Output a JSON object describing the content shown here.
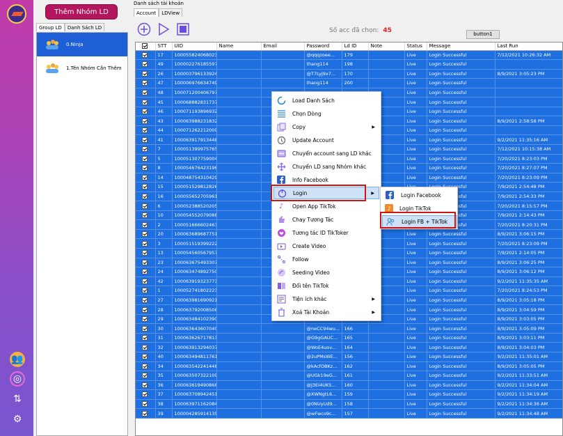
{
  "sidebar": {
    "add_group_button": "Thêm Nhóm LD",
    "tabs": [
      "Group LD",
      "Danh Sách LD"
    ],
    "groups": [
      {
        "label": "0.Ninja",
        "selected": true
      },
      {
        "label": "1.Tên Nhóm Cần Thêm",
        "selected": false
      }
    ],
    "strip_icons": [
      "group-icon",
      "refresh-circle-icon",
      "sync-icon",
      "settings-icon"
    ]
  },
  "main": {
    "section_title": "Danh sách tài khoản",
    "tabs": [
      "Account",
      "LDView"
    ],
    "toolbar_icons": [
      "add-icon",
      "play-icon",
      "stop-icon"
    ],
    "selected_label": "Số acc đã chọn:",
    "selected_count": "45",
    "button1_label": "button1"
  },
  "table": {
    "columns": [
      "STT",
      "UID",
      "Name",
      "Email",
      "Password",
      "Ld ID",
      "Note",
      "Status",
      "Message",
      "Last Run"
    ],
    "rows": [
      [
        "17",
        "100055824068023",
        "",
        "",
        "@qqqzoee...",
        "179",
        "",
        "Live",
        "Login Successful",
        "7/12/2021 10:26:32 AM"
      ],
      [
        "49",
        "100002276185597",
        "",
        "",
        "thang114",
        "198",
        "",
        "Live",
        "Login Successful",
        ""
      ],
      [
        "26",
        "100003796133924",
        "",
        "",
        "@T7Lyj9x7...",
        "170",
        "",
        "Live",
        "Login Successful",
        "8/9/2021 3:05:23 PM"
      ],
      [
        "47",
        "100006976634749",
        "",
        "",
        "thang114",
        "200",
        "",
        "Live",
        "Login Successful",
        ""
      ],
      [
        "48",
        "100071200406797",
        "",
        "",
        "",
        "",
        "",
        "Live",
        "Login Successful",
        ""
      ],
      [
        "45",
        "100068882831737",
        "",
        "",
        "",
        "",
        "",
        "Live",
        "Login Successful",
        ""
      ],
      [
        "46",
        "100071193896932",
        "",
        "",
        "",
        "",
        "",
        "Live",
        "Login Successful",
        ""
      ],
      [
        "43",
        "100063988231832",
        "",
        "",
        "",
        "",
        "",
        "Live",
        "Login Successful",
        "8/9/2021 2:58:58 PM"
      ],
      [
        "44",
        "100071262212009",
        "",
        "",
        "",
        "",
        "",
        "Live",
        "Login Successful",
        ""
      ],
      [
        "41",
        "100063917913448",
        "",
        "",
        "",
        "",
        "",
        "Live",
        "Login Successful",
        "9/2/2021 11:35:16 AM"
      ],
      [
        "7",
        "100051399975765",
        "",
        "",
        "",
        "",
        "",
        "Live",
        "Login Successful",
        "7/12/2021 10:15:38 AM"
      ],
      [
        "5",
        "100051307759004",
        "",
        "",
        "",
        "",
        "",
        "Live",
        "Login Successful",
        "7/20/2021 8:23:03 PM"
      ],
      [
        "8",
        "100054676423196",
        "",
        "",
        "",
        "",
        "",
        "Live",
        "Login Successful",
        "7/20/2021 8:27:07 PM"
      ],
      [
        "14",
        "100048754310429",
        "",
        "",
        "",
        "",
        "",
        "Live",
        "Login Successful",
        "7/20/2021 8:23:09 PM"
      ],
      [
        "15",
        "100051529812826",
        "",
        "",
        "",
        "",
        "",
        "Live",
        "Login Successful",
        "7/9/2021 2:54:48 PM"
      ],
      [
        "16",
        "100055652705961",
        "",
        "",
        "",
        "",
        "",
        "Live",
        "Login Successful",
        "7/9/2021 2:54:33 PM"
      ],
      [
        "6",
        "100052388520205",
        "",
        "",
        "",
        "",
        "",
        "Live",
        "Login Successful",
        "7/20/2021 8:15:57 PM"
      ],
      [
        "10",
        "100054552079088",
        "",
        "",
        "",
        "",
        "",
        "Live",
        "Login Successful",
        "7/9/2021 2:14:43 PM"
      ],
      [
        "2",
        "100051666602463",
        "",
        "",
        "",
        "",
        "",
        "Live",
        "Login Successful",
        "7/20/2021 8:20:31 PM"
      ],
      [
        "20",
        "100063689687751",
        "",
        "",
        "",
        "",
        "",
        "Live",
        "Login Successful",
        "8/9/2021 3:06:15 PM"
      ],
      [
        "3",
        "100051519399222",
        "",
        "",
        "",
        "",
        "",
        "Live",
        "Login Successful",
        "7/20/2021 8:23:09 PM"
      ],
      [
        "13",
        "100054560567957",
        "",
        "",
        "",
        "",
        "",
        "Live",
        "Login Successful",
        "7/9/2021 2:14:05 PM"
      ],
      [
        "23",
        "100063675493307",
        "",
        "",
        "",
        "",
        "",
        "Live",
        "Login Successful",
        "8/9/2021 3:06:25 PM"
      ],
      [
        "24",
        "100063474892750",
        "",
        "",
        "",
        "",
        "",
        "Live",
        "Login Successful",
        "8/9/2021 3:06:12 PM"
      ],
      [
        "42",
        "100063919323773",
        "",
        "",
        "",
        "",
        "",
        "Live",
        "Login Successful",
        "9/2/2021 11:35:35 AM"
      ],
      [
        "1",
        "100052741802223",
        "",
        "",
        "",
        "",
        "",
        "Live",
        "Login Successful",
        "7/20/2021 8:24:53 PM"
      ],
      [
        "27",
        "100063981690921",
        "",
        "",
        "",
        "",
        "",
        "Live",
        "Login Successful",
        "8/9/2021 3:05:18 PM"
      ],
      [
        "28",
        "100063792008506",
        "",
        "",
        "",
        "",
        "",
        "Live",
        "Login Successful",
        "8/9/2021 3:04:59 PM"
      ],
      [
        "29",
        "100063484102390",
        "",
        "",
        "@C00Und8...",
        "167",
        "",
        "Live",
        "Login Successful",
        "8/9/2021 3:03:05 PM"
      ],
      [
        "30",
        "100063643607040",
        "",
        "",
        "@neCC94wu...",
        "166",
        "",
        "Live",
        "Login Successful",
        "8/9/2021 3:05:09 PM"
      ],
      [
        "31",
        "100063626717813",
        "",
        "",
        "@G9gGAUC...",
        "165",
        "",
        "Live",
        "Login Successful",
        "8/9/2021 3:03:11 PM"
      ],
      [
        "32",
        "100063913294037",
        "",
        "",
        "@WoE4uov...",
        "164",
        "",
        "Live",
        "Login Successful",
        "8/9/2021 3:04:03 PM"
      ],
      [
        "40",
        "100063494811761",
        "",
        "",
        "@2uPMsWE...",
        "156",
        "",
        "Live",
        "Login Successful",
        "9/2/2021 11:35:01 AM"
      ],
      [
        "34",
        "100063542241448",
        "",
        "",
        "@kAcfOBKz...",
        "162",
        "",
        "Live",
        "Login Successful",
        "8/9/2021 3:05:05 PM"
      ],
      [
        "35",
        "100063507322109",
        "",
        "",
        "@UGk19eG...",
        "161",
        "",
        "Live",
        "Login Successful",
        "9/2/2021 11:33:51 AM"
      ],
      [
        "36",
        "100063619490866",
        "",
        "",
        "@J3EI4UK5...",
        "160",
        "",
        "Live",
        "Login Successful",
        "9/2/2021 11:34:04 AM"
      ],
      [
        "37",
        "100063708942451",
        "",
        "",
        "@XWNgtL6...",
        "159",
        "",
        "Live",
        "Login Successful",
        "9/2/2021 11:34:19 AM"
      ],
      [
        "38",
        "100063971162084",
        "",
        "",
        "@0NUyUd9...",
        "158",
        "",
        "Live",
        "Login Successful",
        "9/2/2021 11:34:36 AM"
      ],
      [
        "39",
        "100004285914135",
        "",
        "",
        "@wFwco9c...",
        "157",
        "",
        "Live",
        "Login Successful",
        "9/2/2021 11:34:48 AM"
      ]
    ]
  },
  "context_menu": {
    "items": [
      {
        "label": "Load Danh Sách",
        "icon": "refresh-icon",
        "has_submenu": false
      },
      {
        "label": "Chọn Dòng",
        "icon": "list-icon",
        "has_submenu": false
      },
      {
        "label": "Copy",
        "icon": "copy-icon",
        "has_submenu": true
      },
      {
        "label": "Update Account",
        "icon": "update-icon",
        "has_submenu": false
      },
      {
        "label": "Chuyển account sang LD khác",
        "icon": "transfer-icon",
        "has_submenu": false
      },
      {
        "label": "Chuyển LD sang Nhóm khác",
        "icon": "move-icon",
        "has_submenu": false
      },
      {
        "label": "Info Facebook",
        "icon": "facebook-icon",
        "has_submenu": false
      },
      {
        "label": "Login",
        "icon": "power-icon",
        "has_submenu": true,
        "highlighted": true
      },
      {
        "label": "Open App TikTok",
        "icon": "tiktok-icon",
        "has_submenu": false
      },
      {
        "label": "Chay Tương Tác",
        "icon": "interact-icon",
        "has_submenu": false
      },
      {
        "label": "Tương tác ID TikToker",
        "icon": "heart-icon",
        "has_submenu": false
      },
      {
        "label": "Create Video",
        "icon": "video-icon",
        "has_submenu": false
      },
      {
        "label": "Follow",
        "icon": "follow-icon",
        "has_submenu": false
      },
      {
        "label": "Seeding Video",
        "icon": "seeding-icon",
        "has_submenu": false
      },
      {
        "label": "Đổi tên TikTok",
        "icon": "rename-icon",
        "has_submenu": false
      },
      {
        "label": "Tiện ích khác",
        "icon": "tools-icon",
        "has_submenu": true
      },
      {
        "label": "Xoá Tài Khoản",
        "icon": "delete-icon",
        "has_submenu": true
      }
    ]
  },
  "submenu": {
    "items": [
      {
        "label": "Login Facebook",
        "icon": "facebook-icon"
      },
      {
        "label": "Login TikTok",
        "icon": "tiktok-icon"
      },
      {
        "label": "Login FB + TikTok",
        "icon": "fb-tiktok-icon",
        "highlighted": true
      }
    ]
  },
  "colors": {
    "row_selected": "#1e6fe0",
    "highlight_border": "#d01414",
    "brand_button": "#b3165c"
  }
}
